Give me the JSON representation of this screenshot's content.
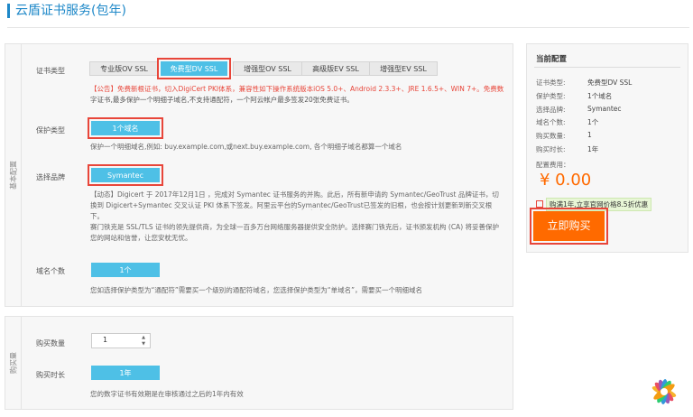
{
  "page": {
    "title": "云盾证书服务(包年)"
  },
  "main": {
    "side_label": "基本配置",
    "cert_type": {
      "label": "证书类型",
      "options": [
        "专业版OV SSL",
        "免费型DV SSL",
        "增强型OV SSL",
        "高级版EV SSL",
        "增强型EV SSL"
      ],
      "selected": "免费型DV SSL"
    },
    "notice": {
      "red": "【公告】免费新根证书，切入DigiCert PKI体系，兼容性如下操作系统版本iOS 5.0+、Android 2.3.3+、JRE 1.6.5+、WIN 7+。免费数",
      "grey": "字证书,最多保护一个明细子域名,不支持通配符，一个阿云帐户最多签发20张免费证书。"
    },
    "protect": {
      "label": "保护类型",
      "option": "1个域名",
      "note": "保护一个明细域名,例如: buy.example.com,或next.buy.example.com, 各个明细子域名都算一个域名"
    },
    "brand": {
      "label": "选择品牌",
      "option": "Symantec",
      "note_lines": [
        "【动态】Digicert 于 2017年12月1日 ，完成对 Symantec 证书服务的并购。此后，所有新申请的 Symantec/GeoTrust 品牌证书，切",
        "换到 Digicert+Symantec 交叉认证 PKI 体系下签发。阿里云平台的Symantec/GeoTrust已签发的旧根，也会按计划更新到新交叉根",
        "下。",
        "赛门铁克是 SSL/TLS 证书的领先提供商，为全球一百多万台网络服务器提供安全防护。选择赛门铁克后，证书颁发机构 (CA) 将妥善保护",
        "您的网站和信誉，让您安枕无忧。"
      ]
    },
    "domain_count": {
      "label": "域名个数",
      "option": "1个",
      "note": "您如选择保护类型为“通配符”需要买一个级别的通配符域名，您选择保护类型为“单域名”，需要买一个明细域名"
    }
  },
  "buy": {
    "side_label": "购买量",
    "quantity": {
      "label": "购买数量",
      "value": "1"
    },
    "duration": {
      "label": "购买时长",
      "option": "1年",
      "note": "您的数字证书有效期是在审核通过之后的1年内有效"
    }
  },
  "summary": {
    "title": "当前配置",
    "rows": [
      {
        "key": "证书类型:",
        "value": "免费型DV SSL"
      },
      {
        "key": "保护类型:",
        "value": "1个域名"
      },
      {
        "key": "选择品牌:",
        "value": "Symantec"
      },
      {
        "key": "域名个数:",
        "value": "1个"
      },
      {
        "key": "购买数量:",
        "value": "1"
      },
      {
        "key": "购买时长:",
        "value": "1年"
      }
    ],
    "price_label": "配置费用：",
    "price": "¥ 0.00",
    "promo": "购满1年,立享官网价格8.5折优惠",
    "buy_button": "立即购买"
  },
  "colors": {
    "accent": "#4ec0e6",
    "highlight": "#e8463a",
    "buy": "#ff6a00"
  }
}
